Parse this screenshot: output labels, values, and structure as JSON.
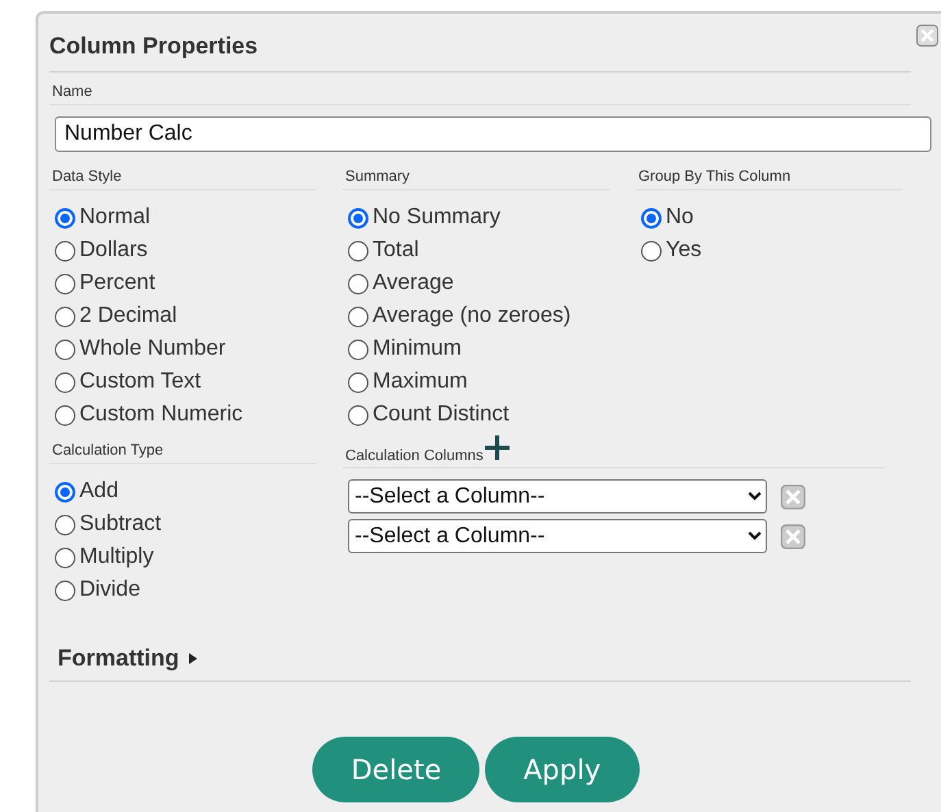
{
  "title": "Column Properties",
  "name_field": {
    "label": "Name",
    "value": "Number Calc"
  },
  "groups": [
    {
      "label": "Data Style",
      "options": [
        {
          "label": "Normal",
          "selected": true
        },
        {
          "label": "Dollars",
          "selected": false
        },
        {
          "label": "Percent",
          "selected": false
        },
        {
          "label": "2 Decimal",
          "selected": false
        },
        {
          "label": "Whole Number",
          "selected": false
        },
        {
          "label": "Custom Text",
          "selected": false
        },
        {
          "label": "Custom Numeric",
          "selected": false
        }
      ]
    },
    {
      "label": "Summary",
      "options": [
        {
          "label": "No Summary",
          "selected": true
        },
        {
          "label": "Total",
          "selected": false
        },
        {
          "label": "Average",
          "selected": false
        },
        {
          "label": "Average (no zeroes)",
          "selected": false
        },
        {
          "label": "Minimum",
          "selected": false
        },
        {
          "label": "Maximum",
          "selected": false
        },
        {
          "label": "Count Distinct",
          "selected": false
        }
      ]
    },
    {
      "label": "Group By This Column",
      "options": [
        {
          "label": "No",
          "selected": true
        },
        {
          "label": "Yes",
          "selected": false
        }
      ]
    }
  ],
  "calculation_type": {
    "label": "Calculation Type",
    "options": [
      {
        "label": "Add",
        "selected": true
      },
      {
        "label": "Subtract",
        "selected": false
      },
      {
        "label": "Multiply",
        "selected": false
      },
      {
        "label": "Divide",
        "selected": false
      }
    ]
  },
  "calculation_columns": {
    "label": "Calculation Columns",
    "selects": [
      "--Select a Column--",
      "--Select a Column--"
    ]
  },
  "formatting": {
    "label": "Formatting",
    "expanded": false
  },
  "buttons": [
    "Delete",
    "Apply"
  ]
}
